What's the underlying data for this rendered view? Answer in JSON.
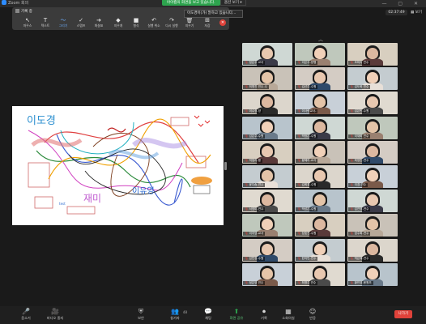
{
  "window": {
    "title": "Zoom 회의",
    "share_banner": "아이캠의 화면을 보고 있습니다.",
    "view_options": "옵션 보기 ▾",
    "controls": "— ▢ ✕"
  },
  "annotation_toolbar": {
    "title": "기록 중",
    "tools": [
      {
        "name": "mouse",
        "icon": "cursor-icon",
        "glyph": "↖",
        "label": "마우스"
      },
      {
        "name": "text",
        "icon": "text-icon",
        "glyph": "T",
        "label": "텍스트"
      },
      {
        "name": "draw",
        "icon": "draw-icon",
        "glyph": "〜",
        "label": "그리기",
        "active": true
      },
      {
        "name": "stamp",
        "icon": "stamp-icon",
        "glyph": "✓",
        "label": "스탬프"
      },
      {
        "name": "spotlight",
        "icon": "arrow-icon",
        "glyph": "➔",
        "label": "화살표"
      },
      {
        "name": "eraser",
        "icon": "eraser-icon",
        "glyph": "◆",
        "label": "지우개"
      },
      {
        "name": "format",
        "icon": "format-icon",
        "glyph": "■",
        "label": "형식"
      },
      {
        "name": "undo",
        "icon": "undo-icon",
        "glyph": "↶",
        "label": "실행 취소"
      },
      {
        "name": "redo",
        "icon": "redo-icon",
        "glyph": "↷",
        "label": "다시 실행"
      },
      {
        "name": "clear",
        "icon": "trash-icon",
        "glyph": "🗑",
        "label": "지우기"
      },
      {
        "name": "save",
        "icon": "save-icon",
        "glyph": "⊞",
        "label": "저장"
      }
    ]
  },
  "notification": "이도경이(가) 말하고 있습니다...",
  "top_right": {
    "timer": "02:37:49",
    "view_label": "▦ 보기"
  },
  "whiteboard": {
    "scribbles": [
      "이도경",
      "재미",
      "이유영"
    ],
    "small_label": "test"
  },
  "participants": [
    {
      "name": "정은주 교사"
    },
    {
      "name": "이은주-양평"
    },
    {
      "name": "조미리 연수"
    },
    {
      "name": "최명진 연수-수"
    },
    {
      "name": "김선주-수원"
    },
    {
      "name": "김도희 연수"
    },
    {
      "name": "이수정-양"
    },
    {
      "name": "이사랑교사-"
    },
    {
      "name": "김은빈-수원"
    },
    {
      "name": "김은주-수원"
    },
    {
      "name": "박정은-수원"
    },
    {
      "name": "이재희 연수"
    },
    {
      "name": "박정리-용"
    },
    {
      "name": "황혜리-교사"
    },
    {
      "name": "최정민-연수"
    },
    {
      "name": "윤다솜-연수"
    },
    {
      "name": "김희경-수원"
    },
    {
      "name": "이경-연수"
    },
    {
      "name": "서영미-연수"
    },
    {
      "name": "박성은-수원"
    },
    {
      "name": "김진영-연수"
    },
    {
      "name": "이지영-교사"
    },
    {
      "name": "장효진-수원"
    },
    {
      "name": "엄수희-연수"
    },
    {
      "name": "임민정-수원"
    },
    {
      "name": "한지민-연수"
    },
    {
      "name": "박은혜-연수"
    },
    {
      "name": "정은영 연수"
    },
    {
      "name": "최명주 연수"
    },
    {
      "name": "황민영-용원초"
    }
  ],
  "bottom_bar": {
    "buttons": [
      {
        "key": "mute",
        "icon": "microphone-icon",
        "glyph": "🎤",
        "label": "음소거"
      },
      {
        "key": "video",
        "icon": "video-camera-icon",
        "glyph": "🎥",
        "label": "비디오 중지"
      },
      {
        "key": "security",
        "icon": "shield-icon",
        "glyph": "⛨",
        "label": "보안"
      },
      {
        "key": "participants",
        "icon": "participants-icon",
        "glyph": "👥",
        "label": "참가자",
        "count": "48"
      },
      {
        "key": "chat",
        "icon": "chat-icon",
        "glyph": "💬",
        "label": "채팅"
      },
      {
        "key": "share",
        "icon": "share-screen-icon",
        "glyph": "⬆",
        "label": "화면 공유"
      },
      {
        "key": "record",
        "icon": "record-icon",
        "glyph": "⏺",
        "label": "기록"
      },
      {
        "key": "breakout",
        "icon": "breakout-rooms-icon",
        "glyph": "▦",
        "label": "소회의실"
      },
      {
        "key": "reactions",
        "icon": "reactions-icon",
        "glyph": "☺",
        "label": "반응"
      }
    ],
    "leave_label": "나가기"
  }
}
